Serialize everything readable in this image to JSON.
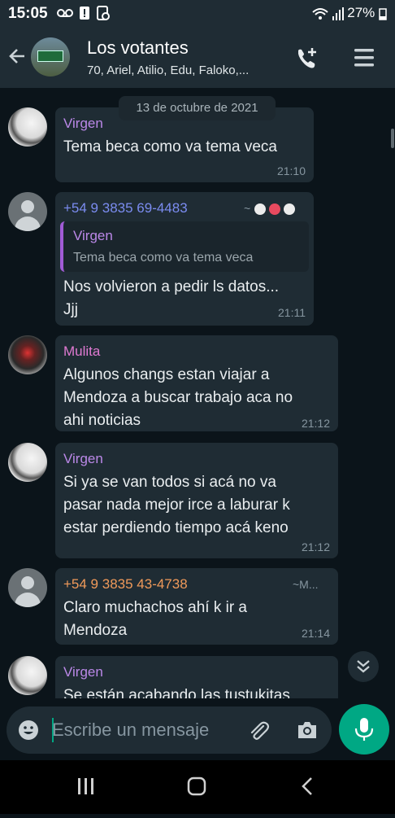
{
  "status": {
    "time": "15:05",
    "battery": "27%"
  },
  "header": {
    "title": "Los votantes",
    "subtitle": "70, Ariel, Atilio, Edu, Faloko,..."
  },
  "date_chip": "13 de octubre de 2021",
  "messages": [
    {
      "sender": "Virgen",
      "text": [
        "Tema beca como va tema veca"
      ],
      "time": "21:10"
    },
    {
      "sender": "+54 9 3835 69-4483",
      "push_name": "~",
      "quoted": {
        "name": "Virgen",
        "text": "Tema beca como va tema veca"
      },
      "text": [
        "Nos volvieron a pedir ls datos...",
        "Jjj"
      ],
      "time": "21:11"
    },
    {
      "sender": "Mulita",
      "text": [
        "Algunos changs estan viajar a",
        "Mendoza a buscar trabajo aca no",
        "ahi noticias"
      ],
      "time": "21:12"
    },
    {
      "sender": "Virgen",
      "text": [
        "Si ya se van todos si acá no va",
        "pasar nada mejor irce a laburar k",
        "estar perdiendo tiempo acá keno"
      ],
      "time": "21:12"
    },
    {
      "sender": "+54 9 3835 43-4738",
      "push_name": "~M...",
      "text": [
        "Claro muchachos ahí k ir a",
        "Mendoza"
      ],
      "time": "21:14"
    },
    {
      "sender": "Virgen",
      "text": [
        "Se están acabando las tustukitas"
      ]
    }
  ],
  "input": {
    "placeholder": "Escribe un mensaje"
  },
  "colors": {
    "virgen": "#bb88e8",
    "phone1": "#7b8cf0",
    "mulita": "#e07ad2",
    "phone2": "#f09a5a",
    "accent": "#00a884"
  }
}
